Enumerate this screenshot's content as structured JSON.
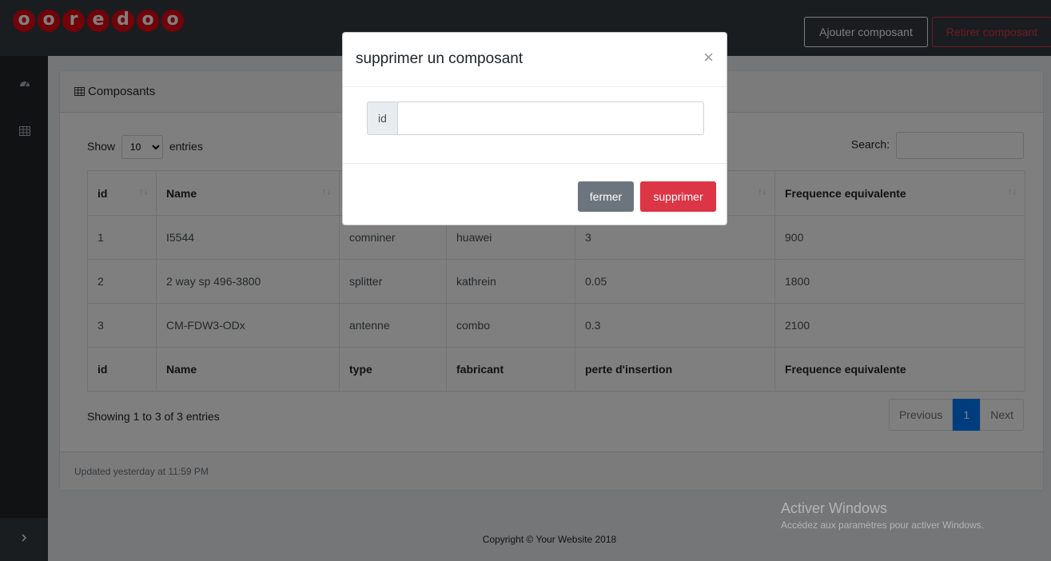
{
  "brand": {
    "logo_letters": [
      "o",
      "o",
      "r",
      "e",
      "d",
      "o",
      "o"
    ],
    "logo_color": "#e30613"
  },
  "navbar": {
    "add_label": "Ajouter composant",
    "remove_label": "Retirer composant"
  },
  "sidebar": {
    "icons": [
      "dashboard-icon",
      "table-icon"
    ],
    "toggle_icon": "chevron-right-icon"
  },
  "card": {
    "header_title": "Composants",
    "header_icon": "table-icon",
    "footer_text": "Updated yesterday at 11:59 PM"
  },
  "datatable": {
    "show_label": "Show",
    "entries_label": "entries",
    "length_value": "10",
    "search_label": "Search:",
    "columns": [
      "id",
      "Name",
      "type",
      "fabricant",
      "perte d'insertion",
      "Frequence equivalente"
    ],
    "rows": [
      [
        "1",
        "I5544",
        "comniner",
        "huawei",
        "3",
        "900"
      ],
      [
        "2",
        "2 way sp 496-3800",
        "splitter",
        "kathrein",
        "0.05",
        "1800"
      ],
      [
        "3",
        "CM-FDW3-ODx",
        "antenne",
        "combo",
        "0.3",
        "2100"
      ]
    ],
    "info": "Showing 1 to 3 of 3 entries",
    "pager": {
      "previous": "Previous",
      "current": "1",
      "next": "Next"
    }
  },
  "page_footer": "Copyright © Your Website 2018",
  "modal": {
    "title": "supprimer un composant",
    "close_glyph": "×",
    "addon_label": "id",
    "input_value": "",
    "close_button": "fermer",
    "delete_button": "supprimer"
  },
  "watermark": {
    "title": "Activer Windows",
    "subtitle": "Accédez aux paramètres pour activer Windows."
  },
  "colors": {
    "danger": "#dc3545",
    "primary": "#007bff",
    "secondary": "#6c757d",
    "navbar": "#343a40"
  }
}
